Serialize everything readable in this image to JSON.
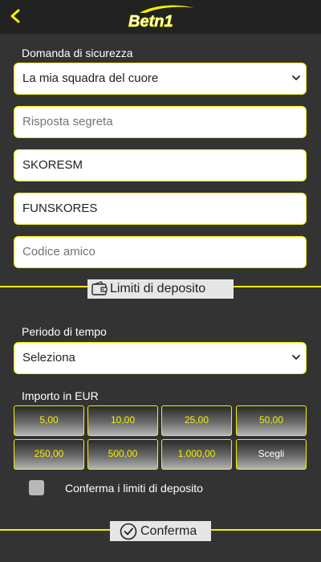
{
  "header": {
    "logo_text": "Betn1"
  },
  "security": {
    "label": "Domanda di sicurezza",
    "question_value": "La mia squadra del cuore",
    "answer_placeholder": "Risposta segreta",
    "field3_value": "SKORESM",
    "field4_value": "FUNSKORES",
    "friend_code_placeholder": "Codice amico"
  },
  "deposit_limits": {
    "section_title": "Limiti di deposito",
    "period_label": "Periodo di tempo",
    "period_value": "Seleziona",
    "amount_label": "Importo in EUR",
    "amounts": [
      "5,00",
      "10,00",
      "25,00",
      "50,00",
      "250,00",
      "500,00",
      "1.000,00",
      "Scegli"
    ],
    "confirm_checkbox_label": "Conferma i limiti di deposito"
  },
  "footer": {
    "confirm_label": "Conferma"
  },
  "colors": {
    "accent": "#f5f000",
    "background": "#333333",
    "topbar": "#222222"
  }
}
